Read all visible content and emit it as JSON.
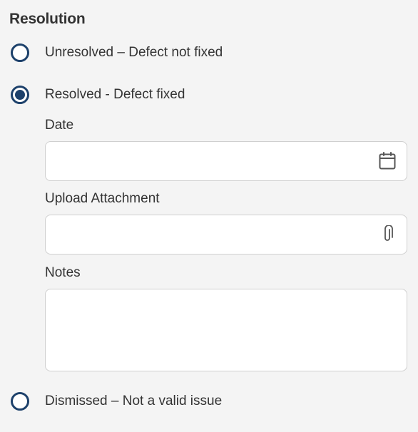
{
  "section": {
    "title": "Resolution"
  },
  "options": {
    "unresolved": {
      "label": "Unresolved – Defect not fixed",
      "selected": false
    },
    "resolved": {
      "label": "Resolved - Defect fixed",
      "selected": true
    },
    "dismissed": {
      "label": "Dismissed – Not a valid issue",
      "selected": false
    }
  },
  "fields": {
    "date": {
      "label": "Date",
      "value": "",
      "icon": "calendar-icon"
    },
    "attachment": {
      "label": "Upload Attachment",
      "value": "",
      "icon": "paperclip-icon"
    },
    "notes": {
      "label": "Notes",
      "value": ""
    }
  },
  "colors": {
    "accent": "#1d416b",
    "text": "#333333",
    "background": "#f4f4f4",
    "field_border": "#cfcfcf",
    "icon": "#555555"
  }
}
